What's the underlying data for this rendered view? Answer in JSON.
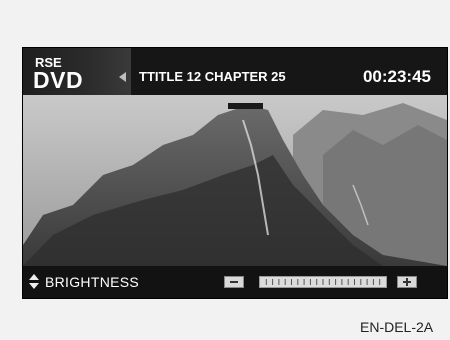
{
  "screen": {
    "source_top": "RSE",
    "source_main": "DVD",
    "title_chapter": "TTITLE 12 CHAPTER 25",
    "time": "00:23:45"
  },
  "controls": {
    "label": "BRIGHTNESS",
    "level_fraction": 1.0
  },
  "caption": "EN-DEL-2A",
  "colors": {
    "bar_background": "#141414",
    "text": "#ffffff",
    "level_fill": "#dcdcdc"
  },
  "icons": {
    "source_arrow": "left-arrow-icon",
    "adjust": "up-down-arrows-icon",
    "decrease": "minus-icon",
    "increase": "plus-icon"
  }
}
